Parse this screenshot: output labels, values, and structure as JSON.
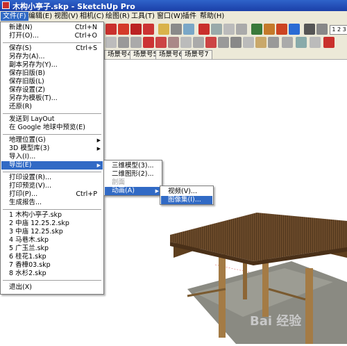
{
  "window": {
    "title": "木构小亭子.skp - SketchUp Pro"
  },
  "menubar": [
    {
      "label": "文件(F)"
    },
    {
      "label": "编辑(E)"
    },
    {
      "label": "视图(V)"
    },
    {
      "label": "相机(C)"
    },
    {
      "label": "绘图(R)"
    },
    {
      "label": "工具(T)"
    },
    {
      "label": "窗口(W)"
    },
    {
      "label": "插件"
    },
    {
      "label": "帮助(H)"
    }
  ],
  "file_menu": [
    {
      "label": "新建(N)",
      "shortcut": "Ctrl+N"
    },
    {
      "label": "打开(O)...",
      "shortcut": "Ctrl+O"
    },
    {
      "label": "保存(S)",
      "shortcut": "Ctrl+S"
    },
    {
      "label": "另存为(A)..."
    },
    {
      "label": "副本另存为(Y)..."
    },
    {
      "label": "保存旧版(B)"
    },
    {
      "label": "保存旧版(L)"
    },
    {
      "label": "保存设置(Z)"
    },
    {
      "label": "另存为模板(T)..."
    },
    {
      "label": "还原(R)"
    },
    {
      "label": "发送到 LayOut"
    },
    {
      "label": "在 Google 地球中预览(E)"
    },
    {
      "label": "地理位置(G)"
    },
    {
      "label": "3D 模型库(3)"
    },
    {
      "label": "导入(I)..."
    },
    {
      "label": "导出(E)"
    },
    {
      "label": "打印设置(R)..."
    },
    {
      "label": "打印预览(V)..."
    },
    {
      "label": "打印(P)...",
      "shortcut": "Ctrl+P"
    },
    {
      "label": "生成报告..."
    },
    {
      "label": "1 木构小亭子.skp"
    },
    {
      "label": "2 中庙 12.25.2.skp"
    },
    {
      "label": "3 中庙 12.25.skp"
    },
    {
      "label": "4 马巷木.skp"
    },
    {
      "label": "5 广玉兰.skp"
    },
    {
      "label": "6 桂花1.skp"
    },
    {
      "label": "7 香樟03.skp"
    },
    {
      "label": "8 水杉2.skp"
    },
    {
      "label": "退出(X)"
    }
  ],
  "export_submenu": [
    {
      "label": "三维模型(3)..."
    },
    {
      "label": "二维图形(2)..."
    },
    {
      "label": "剖面"
    },
    {
      "label": "动画(A)"
    }
  ],
  "animation_submenu": [
    {
      "label": "视频(V)..."
    },
    {
      "label": "图像集(I)..."
    }
  ],
  "scene_tabs": [
    {
      "label": "场景号4"
    },
    {
      "label": "场景号5"
    },
    {
      "label": "场景号6"
    },
    {
      "label": "场景号7"
    }
  ],
  "watermark": {
    "text": "Bai 经验"
  }
}
